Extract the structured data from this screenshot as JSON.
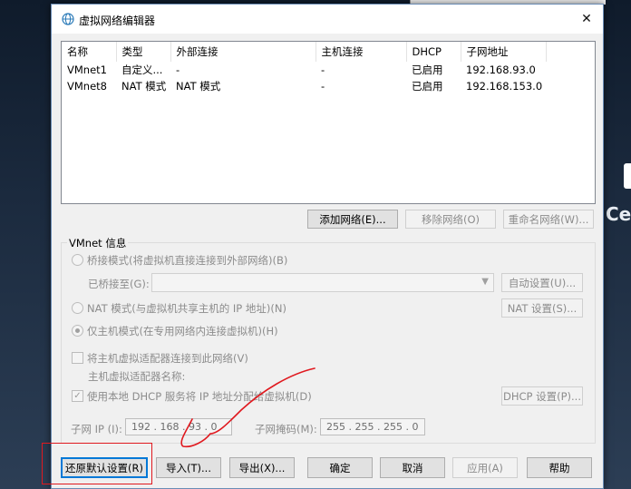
{
  "dialog": {
    "title": "虚拟网络编辑器",
    "close_glyph": "✕"
  },
  "netlist": {
    "columns": [
      "名称",
      "类型",
      "外部连接",
      "主机连接",
      "DHCP",
      "子网地址"
    ],
    "rows": [
      [
        "VMnet1",
        "自定义...",
        "-",
        "-",
        "已启用",
        "192.168.93.0"
      ],
      [
        "VMnet8",
        "NAT 模式",
        "NAT 模式",
        "-",
        "已启用",
        "192.168.153.0"
      ]
    ]
  },
  "list_buttons": {
    "add": "添加网络(E)...",
    "remove": "移除网络(O)",
    "rename": "重命名网络(W)..."
  },
  "vmnet_info": {
    "group_label": "VMnet 信息",
    "bridged_label": "桥接模式(将虚拟机直接连接到外部网络)(B)",
    "bridged_to_label": "已桥接至(G):",
    "auto_settings": "自动设置(U)...",
    "nat_label": "NAT 模式(与虚拟机共享主机的 IP 地址)(N)",
    "nat_settings": "NAT 设置(S)...",
    "host_only_label": "仅主机模式(在专用网络内连接虚拟机)(H)",
    "connect_adapter_label": "将主机虚拟适配器连接到此网络(V)",
    "adapter_name_label": "主机虚拟适配器名称:",
    "dhcp_label": "使用本地 DHCP 服务将 IP 地址分配给虚拟机(D)",
    "dhcp_settings": "DHCP 设置(P)...",
    "subnet_ip_label": "子网 IP (I):",
    "subnet_ip_value": "192 . 168 . 93  .  0",
    "subnet_mask_label": "子网掩码(M):",
    "subnet_mask_value": "255 . 255 . 255 .  0"
  },
  "footer": {
    "restore": "还原默认设置(R)",
    "import": "导入(T)...",
    "export": "导出(X)...",
    "ok": "确定",
    "cancel": "取消",
    "apply": "应用(A)",
    "help": "帮助"
  },
  "desktop": {
    "partial_text": "Ce"
  },
  "colors": {
    "annotation": "#e0191f",
    "focus_border": "#0078d7"
  }
}
